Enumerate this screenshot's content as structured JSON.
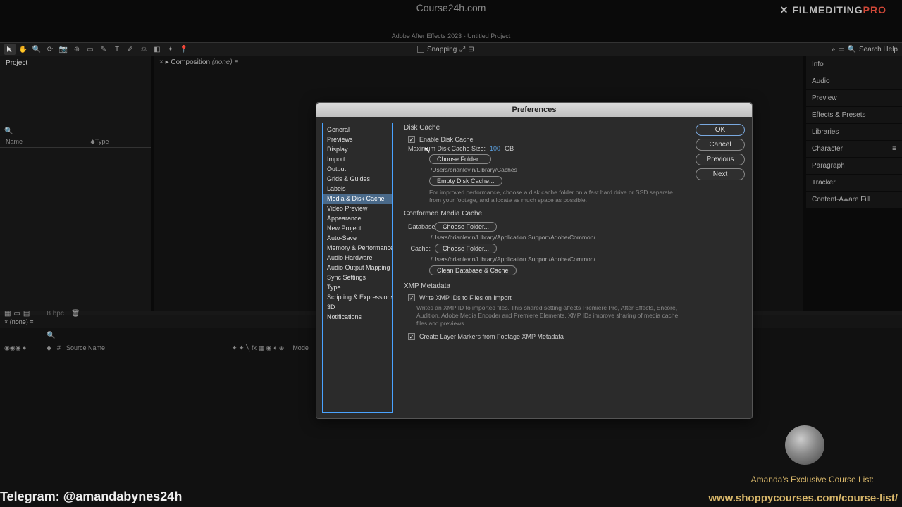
{
  "watermark_top": "Course24h.com",
  "brand": {
    "left": "✕ FILMEDITING",
    "right": "PRO"
  },
  "title_bar": "Adobe After Effects 2023 - Untitled Project",
  "toolbar": {
    "snapping_label": "Snapping",
    "search_help": "Search Help"
  },
  "project_panel": {
    "title": "Project",
    "col_name": "Name",
    "col_type": "Type"
  },
  "composition_panel": {
    "tab_label": "Composition",
    "none": "(none)"
  },
  "right_panels": [
    "Info",
    "Audio",
    "Preview",
    "Effects & Presets",
    "Libraries",
    "Character",
    "Paragraph",
    "Tracker",
    "Content-Aware Fill"
  ],
  "timeline": {
    "tab": "(none)",
    "source_name": "Source Name",
    "mode": "Mode"
  },
  "preferences": {
    "title": "Preferences",
    "categories": [
      "General",
      "Previews",
      "Display",
      "Import",
      "Output",
      "Grids & Guides",
      "Labels",
      "Media & Disk Cache",
      "Video Preview",
      "Appearance",
      "New Project",
      "Auto-Save",
      "Memory & Performance",
      "Audio Hardware",
      "Audio Output Mapping",
      "Sync Settings",
      "Type",
      "Scripting & Expressions",
      "3D",
      "Notifications"
    ],
    "selected": "Media & Disk Cache",
    "buttons": {
      "ok": "OK",
      "cancel": "Cancel",
      "previous": "Previous",
      "next": "Next"
    },
    "disk_cache": {
      "title": "Disk Cache",
      "enable": "Enable Disk Cache",
      "max_label": "Maximum Disk Cache Size:",
      "max_value": "100",
      "max_unit": "GB",
      "choose_folder": "Choose Folder...",
      "path": "/Users/brianlevin/Library/Caches",
      "empty": "Empty Disk Cache...",
      "help": "For improved performance, choose a disk cache folder on a fast hard drive or SSD separate from your footage, and allocate as much space as possible."
    },
    "conformed": {
      "title": "Conformed Media Cache",
      "database_label": "Database:",
      "cache_label": "Cache:",
      "choose_folder": "Choose Folder...",
      "db_path": "/Users/brianlevin/Library/Application Support/Adobe/Common/",
      "cache_path": "/Users/brianlevin/Library/Application Support/Adobe/Common/",
      "clean": "Clean Database & Cache"
    },
    "xmp": {
      "title": "XMP Metadata",
      "write": "Write XMP IDs to Files on Import",
      "write_help": "Writes an XMP ID to imported files. This shared setting affects Premiere Pro, After Effects, Encore, Audition, Adobe Media Encoder and Premiere Elements. XMP IDs improve sharing of media cache files and previews.",
      "layer_markers": "Create Layer Markers from Footage XMP Metadata"
    }
  },
  "overlay": {
    "telegram": "Telegram: @amandabynes24h",
    "course_list": "Amanda's Exclusive Course List:",
    "course_url": "www.shoppycourses.com/course-list/"
  }
}
